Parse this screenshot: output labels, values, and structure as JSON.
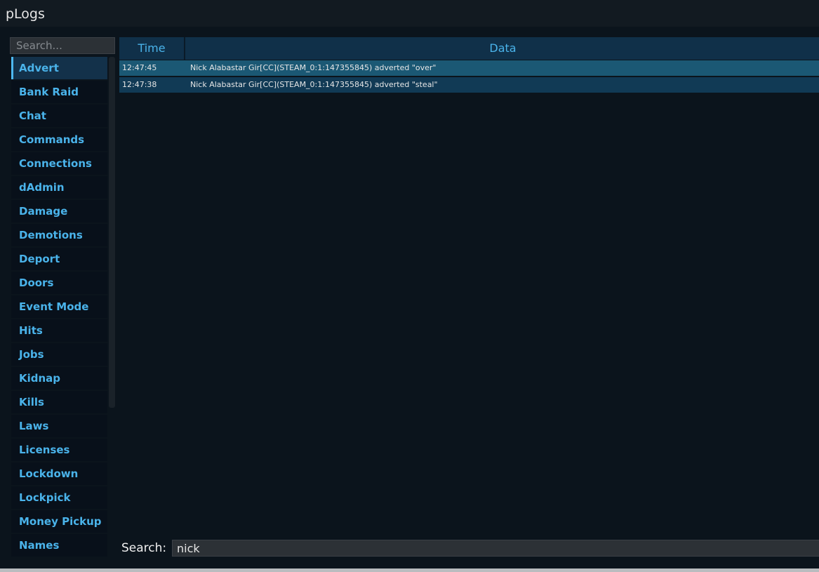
{
  "window": {
    "title": "pLogs"
  },
  "sidebar": {
    "search_placeholder": "Search...",
    "items": [
      {
        "label": "Advert",
        "active": true
      },
      {
        "label": "Bank Raid"
      },
      {
        "label": "Chat"
      },
      {
        "label": "Commands"
      },
      {
        "label": "Connections"
      },
      {
        "label": "dAdmin"
      },
      {
        "label": "Damage"
      },
      {
        "label": "Demotions"
      },
      {
        "label": "Deport"
      },
      {
        "label": "Doors"
      },
      {
        "label": "Event Mode"
      },
      {
        "label": "Hits"
      },
      {
        "label": "Jobs"
      },
      {
        "label": "Kidnap"
      },
      {
        "label": "Kills"
      },
      {
        "label": "Laws"
      },
      {
        "label": "Licenses"
      },
      {
        "label": "Lockdown"
      },
      {
        "label": "Lockpick"
      },
      {
        "label": "Money Pickup"
      },
      {
        "label": "Names"
      }
    ]
  },
  "table": {
    "columns": {
      "time": "Time",
      "data": "Data"
    },
    "rows": [
      {
        "time": "12:47:45",
        "data": "Nick Alabastar Gir[CC](STEAM_0:1:147355845) adverted \"over\""
      },
      {
        "time": "12:47:38",
        "data": "Nick Alabastar Gir[CC](STEAM_0:1:147355845) adverted \"steal\""
      }
    ]
  },
  "filter": {
    "label": "Search:",
    "value": "nick"
  },
  "colors": {
    "accent": "#4ab3ea",
    "selected_row": "#1b5874",
    "row": "#113a55",
    "background": "#0b141c"
  }
}
